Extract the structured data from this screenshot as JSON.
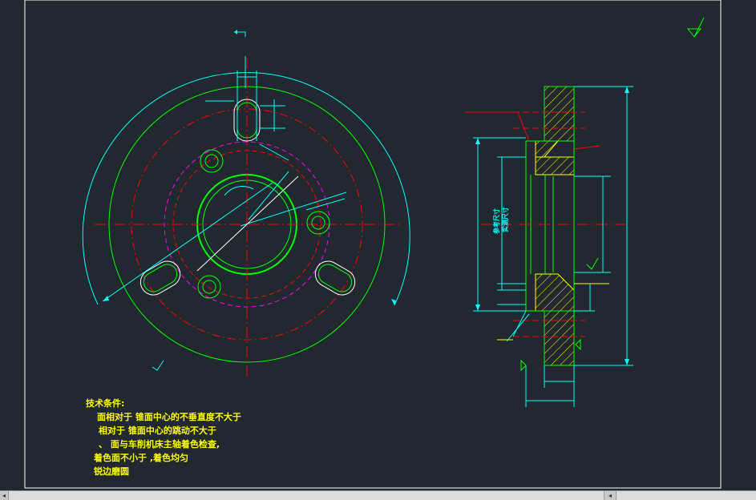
{
  "notes": {
    "title": "技术条件:",
    "lines": [
      "面相对于  锥面中心的不垂直度不大于",
      "相对于  锥面中心的跳动不大于",
      "、   面与车削机床主轴着色检查,",
      "着色面不小于       ,着色均匀",
      "锐边磨圆"
    ]
  },
  "section_labels": {
    "ref_size": "参考尺寸",
    "actual_size": "实测尺寸"
  },
  "colors": {
    "background": "#212830",
    "border": "#ffffff",
    "cyan": "#00ffff",
    "green": "#00ff00",
    "red": "#ff0000",
    "magenta": "#ff00ff",
    "yellow": "#ffff00",
    "white": "#ffffff"
  },
  "icons": [
    "roughness-symbol-icon",
    "section-arrow-icon",
    "scrollbar-left-arrow-icon",
    "scrollbar-right-arrow-icon"
  ]
}
